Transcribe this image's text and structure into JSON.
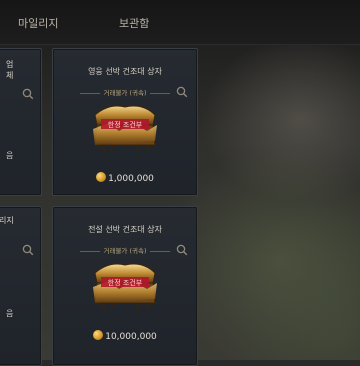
{
  "tabs": [
    {
      "label": "마일리지"
    },
    {
      "label": "보관함"
    }
  ],
  "left_cards": [
    {
      "title_line1": "업",
      "title_line2": "체",
      "tail": "음"
    },
    {
      "title_line1": "리지",
      "tail": "음"
    }
  ],
  "cards": [
    {
      "title": "영웅 선박 건조대 상자",
      "subtitle": "거래불가 (귀속)",
      "stamp": "한정 조건부",
      "price": "1,000,000"
    },
    {
      "title": "전설 선박 건조대 상자",
      "subtitle": "거래불가 (귀속)",
      "stamp": "한정 조건부",
      "price": "10,000,000"
    }
  ],
  "icons": {
    "search": "search-icon",
    "coin": "coin-icon",
    "chest": "chest-icon"
  }
}
